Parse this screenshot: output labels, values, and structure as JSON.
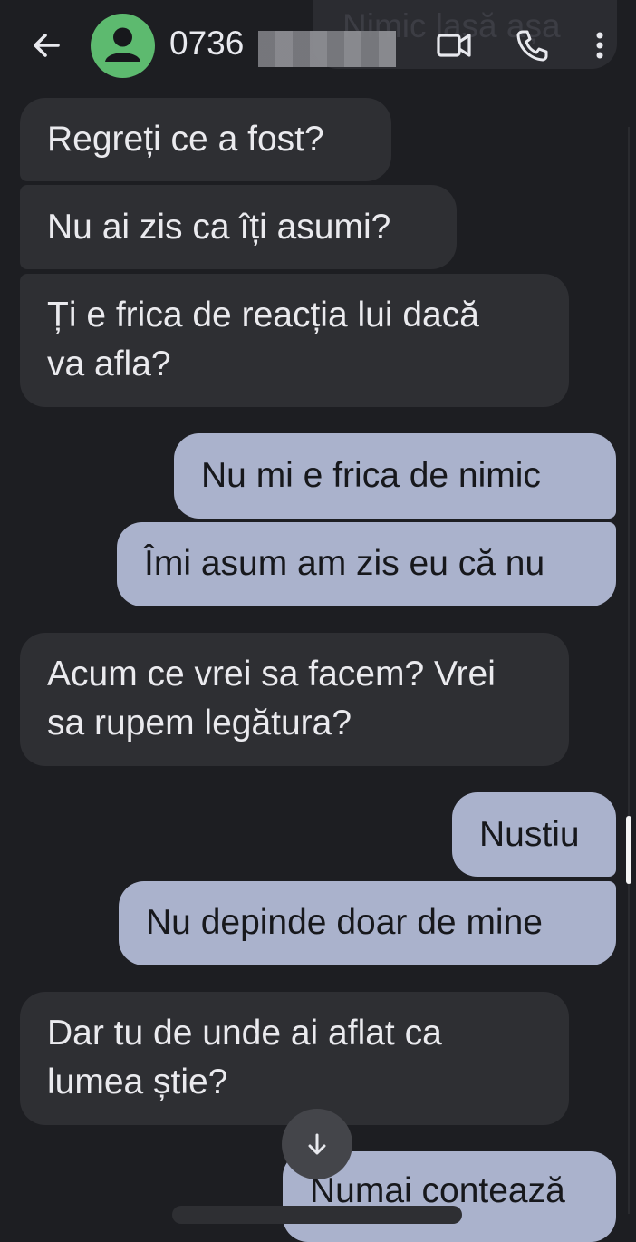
{
  "header": {
    "ghost_text": "Nimic lasă așa",
    "contact_name": "0736",
    "avatar_color": "#5dba6f",
    "icons": [
      "arrow-left-icon",
      "person-icon",
      "video-call-icon",
      "phone-icon",
      "more-vert-icon"
    ]
  },
  "colors": {
    "background": "#1d1e22",
    "incoming_bubble": "#2e2f33",
    "outgoing_bubble": "#aab2cc"
  },
  "messages": [
    {
      "direction": "incoming",
      "text": "Regreți ce a fost?"
    },
    {
      "direction": "incoming",
      "text": "Nu ai zis ca îți asumi?"
    },
    {
      "direction": "incoming",
      "line1": "Ți e frica de reacția lui dacă",
      "line2": "va afla?"
    },
    {
      "direction": "outgoing",
      "text": "Nu mi e frica de nimic"
    },
    {
      "direction": "outgoing",
      "text": "Îmi asum am zis eu că nu"
    },
    {
      "direction": "incoming",
      "line1": "Acum ce vrei sa facem? Vrei",
      "line2": "sa rupem legătura?"
    },
    {
      "direction": "outgoing",
      "text": "Nustiu"
    },
    {
      "direction": "outgoing",
      "text": "Nu depinde doar de mine"
    },
    {
      "direction": "incoming",
      "line1": "Dar tu de unde ai aflat ca",
      "line2": "lumea știe?"
    },
    {
      "direction": "outgoing",
      "text": "Numai contează"
    }
  ]
}
